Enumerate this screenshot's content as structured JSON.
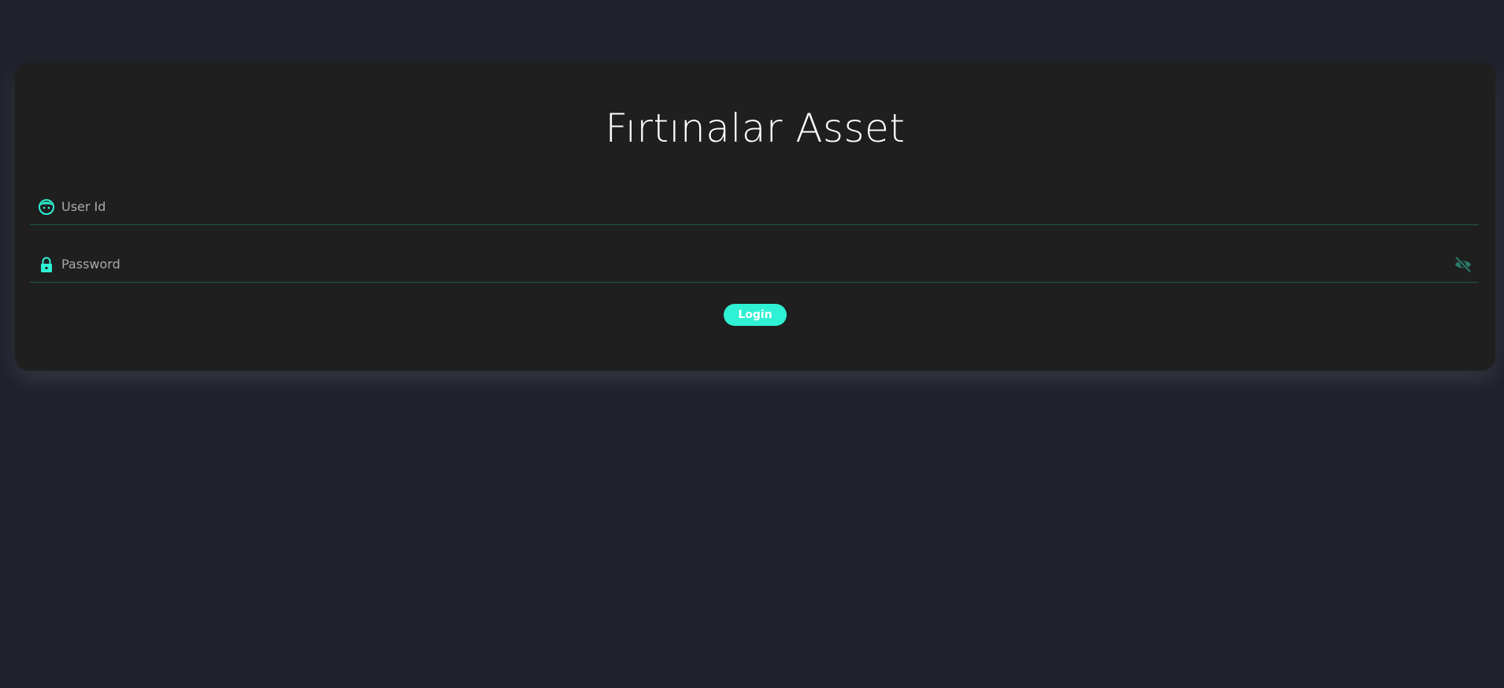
{
  "title": "Fırtınalar Asset",
  "user_field": {
    "placeholder": "User Id",
    "value": "",
    "icon": "face-icon"
  },
  "password_field": {
    "placeholder": "Password",
    "value": "",
    "icon": "lock-icon",
    "toggle_icon": "eye-off-icon"
  },
  "login_button": {
    "label": "Login"
  },
  "colors": {
    "background": "#1f212b",
    "card": "#1f1f1f",
    "accent": "#2ff1d3",
    "underline": "#1f5a45",
    "eye_icon": "#2a7c6a"
  }
}
